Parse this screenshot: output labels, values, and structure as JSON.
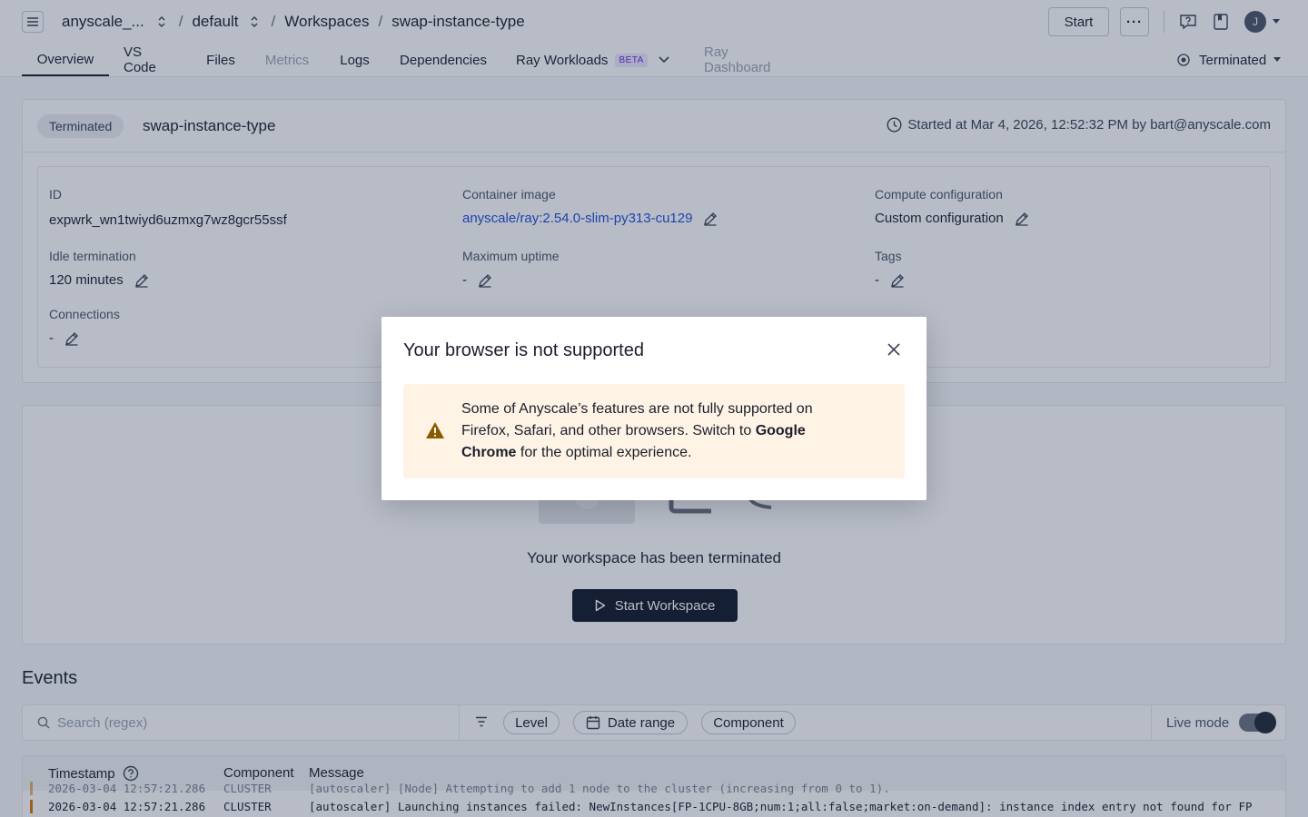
{
  "header": {
    "org": "anyscale_...",
    "project": "default",
    "section": "Workspaces",
    "workspace": "swap-instance-type",
    "start_label": "Start",
    "more_label": "···",
    "avatar_initial": "J"
  },
  "tabs": [
    {
      "label": "Overview",
      "active": true
    },
    {
      "label": "VS Code"
    },
    {
      "label": "Files"
    },
    {
      "label": "Metrics",
      "disabled": true
    },
    {
      "label": "Logs"
    },
    {
      "label": "Dependencies"
    },
    {
      "label": "Ray Workloads",
      "badge": "BETA"
    },
    {
      "label": "Ray Dashboard",
      "disabled": true
    }
  ],
  "status_dropdown": "Terminated",
  "card": {
    "status_pill": "Terminated",
    "title": "swap-instance-type",
    "started": "Started at Mar 4, 2026, 12:52:32 PM by bart@anyscale.com",
    "fields": {
      "id": {
        "label": "ID",
        "value": "expwrk_wn1twiyd6uzmxg7wz8gcr55ssf"
      },
      "container_image": {
        "label": "Container image",
        "value": "anyscale/ray:2.54.0-slim-py313-cu129"
      },
      "compute_config": {
        "label": "Compute configuration",
        "value": "Custom configuration"
      },
      "idle_termination": {
        "label": "Idle termination",
        "value": "120 minutes"
      },
      "max_uptime": {
        "label": "Maximum uptime",
        "value": "-"
      },
      "tags": {
        "label": "Tags",
        "value": "-"
      },
      "connections": {
        "label": "Connections",
        "value": "-"
      }
    }
  },
  "terminated_panel": {
    "message": "Your workspace has been terminated",
    "button": "Start Workspace"
  },
  "events": {
    "title": "Events",
    "search_placeholder": "Search (regex)",
    "chips": [
      "Level",
      "Date range",
      "Component"
    ],
    "live_mode_label": "Live mode",
    "live_mode_on": true,
    "columns": [
      "Timestamp",
      "Component",
      "Message"
    ],
    "rows": [
      {
        "timestamp": "2026-03-04 12:57:21.286",
        "component": "CLUSTER",
        "message": "[autoscaler] [Node] Attempting to add 1 node to the cluster (increasing from 0 to 1)."
      },
      {
        "timestamp": "2026-03-04 12:57:21.286",
        "component": "CLUSTER",
        "message": "[autoscaler] Launching instances failed: NewInstances[FP-1CPU-8GB;num:1;all:false;market:on-demand]: instance index entry not found for FP"
      }
    ]
  },
  "modal": {
    "title": "Your browser is not supported",
    "message_prefix": "Some of Anyscale’s features are not fully supported on Firefox, Safari, and other browsers. Switch to ",
    "message_bold": "Google Chrome",
    "message_suffix": " for the optimal experience."
  },
  "colors": {
    "overlay": "#1e3050",
    "alert_bg": "#fff3e6",
    "warning_icon": "#8a5a00",
    "link": "#1d4ed8",
    "beta_bg": "#ede9fe",
    "beta_text": "#6d28d9"
  }
}
